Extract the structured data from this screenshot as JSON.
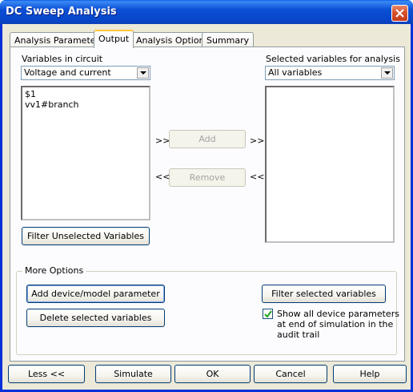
{
  "window": {
    "title": "DC Sweep Analysis"
  },
  "tabs": [
    {
      "label": "Analysis Parameters",
      "active": false
    },
    {
      "label": "Output",
      "active": true
    },
    {
      "label": "Analysis Options",
      "active": false
    },
    {
      "label": "Summary",
      "active": false
    }
  ],
  "left": {
    "heading": "Variables in circuit",
    "filter_select": "Voltage and current",
    "variables": [
      "$1",
      "vv1#branch"
    ],
    "filter_unselected_label": "Filter Unselected Variables"
  },
  "right": {
    "heading": "Selected variables for analysis",
    "filter_select": "All variables",
    "variables": []
  },
  "transfer": {
    "add_label": "Add",
    "remove_label": "Remove",
    "add_arrow_left": ">>",
    "add_arrow_right": ">>",
    "remove_arrow_left": "<<",
    "remove_arrow_right": "<<"
  },
  "more_options": {
    "legend": "More Options",
    "add_device_label": "Add device/model parameter",
    "delete_selected_label": "Delete selected variables",
    "filter_selected_label": "Filter selected variables",
    "show_params_label": "Show all device parameters at end of simulation in the audit trail",
    "show_params_lines": [
      "Show all device parameters",
      "at end of simulation in the",
      "audit trail"
    ],
    "show_params_checked": true
  },
  "footer": {
    "less_label": "Less <<",
    "simulate_label": "Simulate",
    "ok_label": "OK",
    "cancel_label": "Cancel",
    "help_label": "Help"
  },
  "colors": {
    "title_bar": "#0845c8",
    "dialog_face": "#ece9d8",
    "close_button": "#d8522e",
    "tab_highlight": "#ffc83c"
  }
}
